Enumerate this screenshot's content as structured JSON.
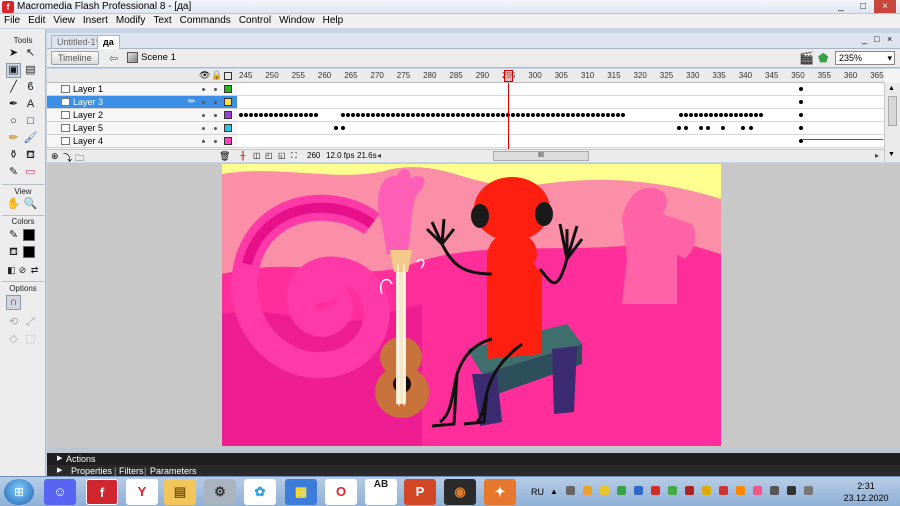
{
  "window": {
    "title": "Macromedia Flash Professional 8 - [да]",
    "controls": [
      "_",
      "□",
      "×"
    ]
  },
  "menu": [
    "File",
    "Edit",
    "View",
    "Insert",
    "Modify",
    "Text",
    "Commands",
    "Control",
    "Window",
    "Help"
  ],
  "tools": {
    "section_tools": "Tools",
    "section_view": "View",
    "section_colors": "Colors",
    "section_options": "Options"
  },
  "tabs": [
    {
      "label": "Untitled-1*"
    },
    {
      "label": "да"
    }
  ],
  "doc_controls": [
    "_",
    "□",
    "×"
  ],
  "editbar": {
    "timeline_label": "Timeline",
    "scene_label": "Scene 1",
    "zoom": "235%"
  },
  "timeline": {
    "ruler": [
      "245",
      "250",
      "255",
      "260",
      "265",
      "270",
      "275",
      "280",
      "285",
      "290",
      "295",
      "300",
      "305",
      "310",
      "315",
      "320",
      "325",
      "330",
      "335",
      "340",
      "345",
      "350",
      "355",
      "360",
      "365"
    ],
    "layers": [
      {
        "name": "Layer 1",
        "color": "#22bb22",
        "selected": false
      },
      {
        "name": "Layer 3",
        "color": "#ffe040",
        "selected": true
      },
      {
        "name": "Layer 2",
        "color": "#9b3fd6",
        "selected": false
      },
      {
        "name": "Layer 5",
        "color": "#22c8e6",
        "selected": false
      },
      {
        "name": "Layer 4",
        "color": "#ff40c0",
        "selected": false
      }
    ],
    "current_frame": "260",
    "fps": "12.0 fps",
    "time": "21.6s",
    "scroll_label": "III"
  },
  "panels": {
    "actions": "Actions",
    "properties": "Properties",
    "filters": "Filters",
    "parameters": "Parameters"
  },
  "taskbar": {
    "lang": "RU",
    "time": "2:31",
    "date": "23.12.2020"
  }
}
